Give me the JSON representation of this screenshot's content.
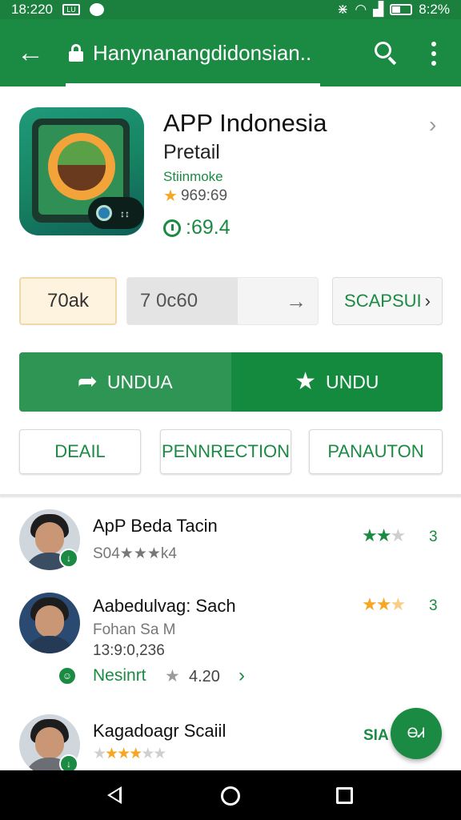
{
  "status_bar": {
    "time": "18:220",
    "box_icon_text": "LU",
    "battery_text": "8:2%"
  },
  "toolbar": {
    "title": "Hanynanangdidonsian.."
  },
  "app": {
    "title": "APP Indonesia",
    "subtitle": "Pretail",
    "developer": "Stiinmoke",
    "rating": "★ 969:69",
    "rating_value": "969:69",
    "count": ":69.4"
  },
  "stats": {
    "first": "70ak",
    "second": "7 0c60",
    "third": "SCAPSUI"
  },
  "actions": {
    "left_label": "UNDUA",
    "right_label": "UNDU"
  },
  "tabs": [
    "DEAIL",
    "PENNRECTION",
    "PANAUTON"
  ],
  "reviews": [
    {
      "name": "ApP Beda Tacin",
      "sub": "S04★★★k4",
      "stars_filled": 2,
      "star_color": "green",
      "score": "3"
    },
    {
      "name": "Aabedulvag: Sach",
      "sub": "Fohan Sa M",
      "date": "13:9:0,236",
      "extra": "Nesinrt",
      "extra_rating": "4.20",
      "stars_filled": 2.5,
      "star_color": "orange",
      "score": "3"
    },
    {
      "name": "Kagadoagr Scaiil",
      "stars_filled": 3,
      "star_color": "orange",
      "score": "SIA"
    }
  ],
  "fab": {
    "label": "ᎾᏗ"
  },
  "colors": {
    "primary": "#1b8a43",
    "accent": "#f5a623"
  }
}
